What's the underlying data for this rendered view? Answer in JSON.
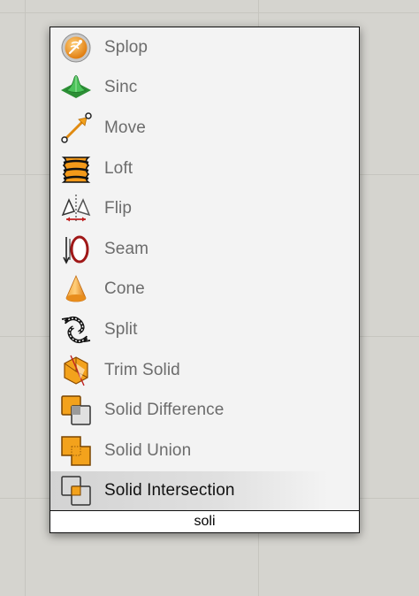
{
  "menu": {
    "items": [
      {
        "label": "Splop",
        "icon": "splop-icon"
      },
      {
        "label": "Sinc",
        "icon": "sinc-icon"
      },
      {
        "label": "Move",
        "icon": "move-icon"
      },
      {
        "label": "Loft",
        "icon": "loft-icon"
      },
      {
        "label": "Flip",
        "icon": "flip-icon"
      },
      {
        "label": "Seam",
        "icon": "seam-icon"
      },
      {
        "label": "Cone",
        "icon": "cone-icon"
      },
      {
        "label": "Split",
        "icon": "split-icon"
      },
      {
        "label": "Trim Solid",
        "icon": "trim-solid-icon"
      },
      {
        "label": "Solid Difference",
        "icon": "solid-difference-icon"
      },
      {
        "label": "Solid Union",
        "icon": "solid-union-icon"
      },
      {
        "label": "Solid Intersection",
        "icon": "solid-intersection-icon"
      }
    ],
    "selected_label": "Solid Intersection"
  },
  "search": {
    "query": "soli"
  },
  "colors": {
    "canvas_background": "#d5d4cf",
    "menu_background": "#f3f3f3",
    "label_text": "#6c6c6c",
    "selected_label_text": "#111111",
    "icon_orange": "#f3a21c",
    "icon_green": "#39a845"
  }
}
